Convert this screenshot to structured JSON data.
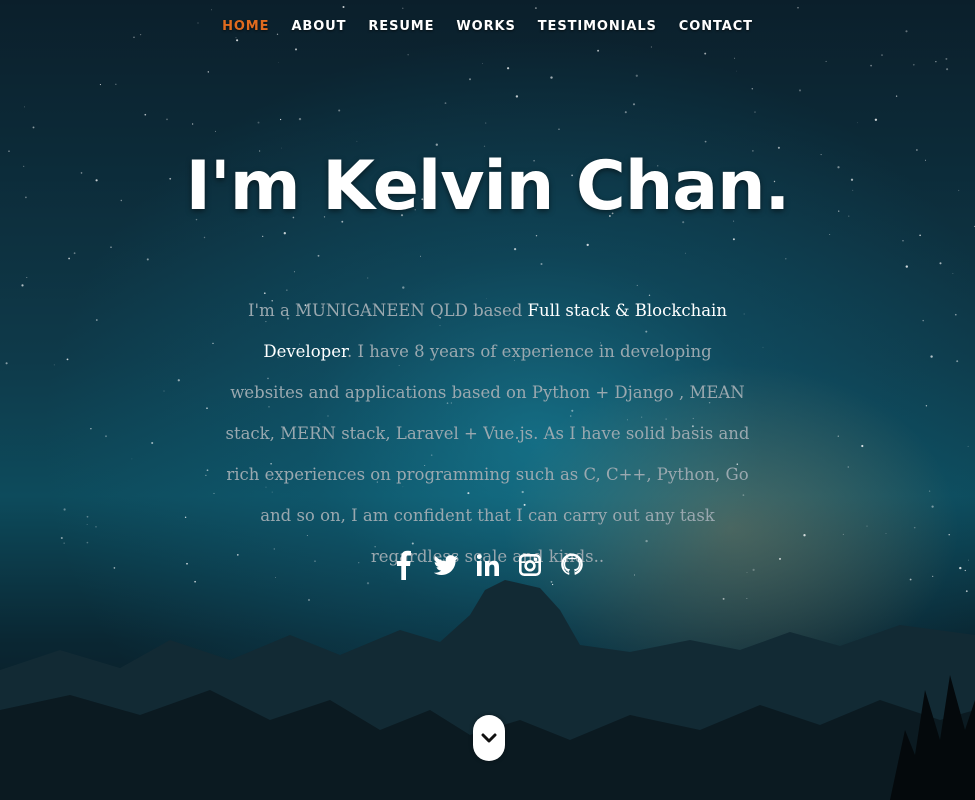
{
  "nav": {
    "items": [
      {
        "label": "HOME",
        "active": true
      },
      {
        "label": "ABOUT",
        "active": false
      },
      {
        "label": "RESUME",
        "active": false
      },
      {
        "label": "WORKS",
        "active": false
      },
      {
        "label": "TESTIMONIALS",
        "active": false
      },
      {
        "label": "CONTACT",
        "active": false
      }
    ],
    "active_color": "#e06b1f"
  },
  "hero": {
    "headline": "I'm Kelvin Chan.",
    "intro_before": "I'm a MUNIGANEEN QLD based ",
    "intro_role": "Full stack & Blockchain Developer",
    "intro_after": ". I have 8 years of experience in developing websites and applications based on Python + Django , MEAN stack, MERN stack, Laravel + Vue.js. As I have solid basis and rich experiences on programming such as C, C++, Python, Go and so on, I am confident that I can carry out any task regardless scale and kinds.."
  },
  "social": [
    {
      "icon": "facebook-icon"
    },
    {
      "icon": "twitter-icon"
    },
    {
      "icon": "linkedin-icon"
    },
    {
      "icon": "instagram-icon"
    },
    {
      "icon": "github-icon"
    }
  ],
  "scroll_down": {
    "icon": "chevron-down-icon"
  }
}
